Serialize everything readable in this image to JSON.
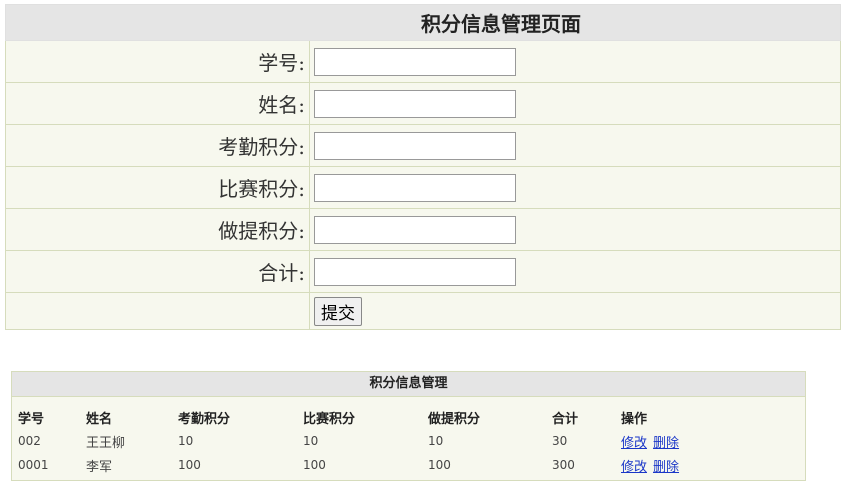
{
  "form": {
    "title": "积分信息管理页面",
    "fields": [
      {
        "label": "学号:",
        "value": ""
      },
      {
        "label": "姓名:",
        "value": ""
      },
      {
        "label": "考勤积分:",
        "value": ""
      },
      {
        "label": "比赛积分:",
        "value": ""
      },
      {
        "label": "做提积分:",
        "value": ""
      },
      {
        "label": "合计:",
        "value": ""
      }
    ],
    "submit_label": "提交"
  },
  "list": {
    "title": "积分信息管理",
    "headers": [
      "学号",
      "姓名",
      "考勤积分",
      "比赛积分",
      "做提积分",
      "合计",
      "操作"
    ],
    "rows": [
      {
        "id": "002",
        "name": "王王柳",
        "attendance": "10",
        "competition": "10",
        "problems": "10",
        "total": "30"
      },
      {
        "id": "0001",
        "name": "李军",
        "attendance": "100",
        "competition": "100",
        "problems": "100",
        "total": "300"
      }
    ],
    "edit_label": "修改",
    "delete_label": "删除"
  }
}
